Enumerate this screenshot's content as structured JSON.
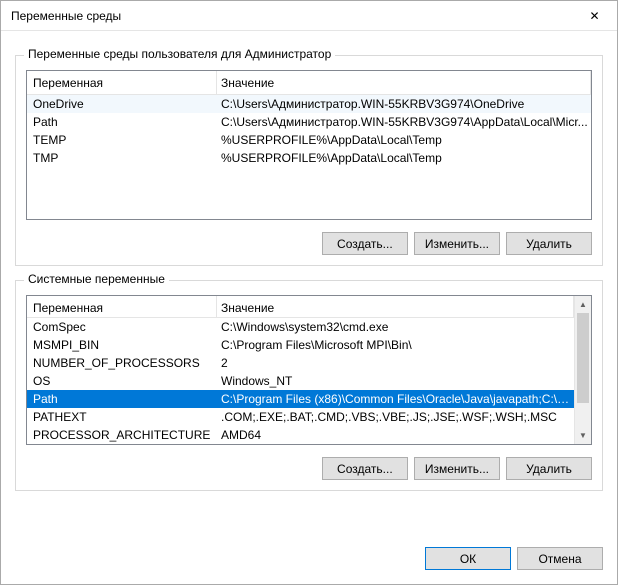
{
  "window": {
    "title": "Переменные среды",
    "close": "✕"
  },
  "user_vars": {
    "label": "Переменные среды пользователя для Администратор",
    "col_var": "Переменная",
    "col_val": "Значение",
    "rows": [
      {
        "name": "OneDrive",
        "value": "C:\\Users\\Администратор.WIN-55KRBV3G974\\OneDrive"
      },
      {
        "name": "Path",
        "value": "C:\\Users\\Администратор.WIN-55KRBV3G974\\AppData\\Local\\Micr..."
      },
      {
        "name": "TEMP",
        "value": "%USERPROFILE%\\AppData\\Local\\Temp"
      },
      {
        "name": "TMP",
        "value": "%USERPROFILE%\\AppData\\Local\\Temp"
      }
    ],
    "selected_index": 0,
    "btn_new": "Создать...",
    "btn_edit": "Изменить...",
    "btn_delete": "Удалить"
  },
  "system_vars": {
    "label": "Системные переменные",
    "col_var": "Переменная",
    "col_val": "Значение",
    "rows": [
      {
        "name": "ComSpec",
        "value": "C:\\Windows\\system32\\cmd.exe"
      },
      {
        "name": "MSMPI_BIN",
        "value": "C:\\Program Files\\Microsoft MPI\\Bin\\"
      },
      {
        "name": "NUMBER_OF_PROCESSORS",
        "value": "2"
      },
      {
        "name": "OS",
        "value": "Windows_NT"
      },
      {
        "name": "Path",
        "value": "C:\\Program Files (x86)\\Common Files\\Oracle\\Java\\javapath;C:\\Pro..."
      },
      {
        "name": "PATHEXT",
        "value": ".COM;.EXE;.BAT;.CMD;.VBS;.VBE;.JS;.JSE;.WSF;.WSH;.MSC"
      },
      {
        "name": "PROCESSOR_ARCHITECTURE",
        "value": "AMD64"
      }
    ],
    "selected_index": 4,
    "btn_new": "Создать...",
    "btn_edit": "Изменить...",
    "btn_delete": "Удалить"
  },
  "footer": {
    "ok": "ОК",
    "cancel": "Отмена"
  }
}
